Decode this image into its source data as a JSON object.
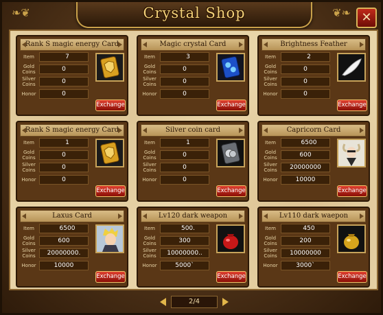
{
  "window": {
    "title": "Crystal Shop",
    "close_label": "✕"
  },
  "labels": {
    "item": "Item",
    "gold": "Gold Coins",
    "silver": "Silver Coins",
    "honor": "Honor"
  },
  "exchange_label": "Exchange",
  "pager": {
    "text": "2/4"
  },
  "cards": [
    {
      "title": "Rank S magic energy Card",
      "item_icon": "green-egg",
      "item": "7",
      "gold": "0",
      "silver": "0",
      "honor": "0",
      "image": "gold-shield-card"
    },
    {
      "title": "Magic crystal Card",
      "item_icon": "green-egg",
      "item": "3",
      "gold": "0",
      "silver": "0",
      "honor": "0",
      "image": "blue-crystal-card"
    },
    {
      "title": "Brightness Feather",
      "item_icon": "green-egg",
      "item": "2",
      "gold": "0",
      "silver": "0",
      "honor": "0",
      "image": "white-feather"
    },
    {
      "title": "Rank S magic energy Card",
      "item_icon": "green-egg",
      "item": "1",
      "gold": "0",
      "silver": "0",
      "honor": "0",
      "image": "gold-shield-card"
    },
    {
      "title": "Silver coin card",
      "item_icon": "green-egg",
      "item": "1",
      "gold": "0",
      "silver": "0",
      "honor": "0",
      "image": "silver-coin-card"
    },
    {
      "title": "Capricorn Card",
      "item_icon": "dark-gem",
      "item": "6500",
      "gold": "600",
      "silver": "20000000",
      "honor": "10000",
      "image": "capricorn-portrait"
    },
    {
      "title": "Laxus Card",
      "item_icon": "dark-gem",
      "item": "6500",
      "gold": "600",
      "silver": "20000000.",
      "honor": "10000",
      "image": "laxus-portrait"
    },
    {
      "title": "Lv120 dark weapon",
      "item_icon": "dark-gem",
      "item": "500.",
      "gold": "300",
      "silver": "10000000..",
      "honor": "5000`",
      "image": "red-bag"
    },
    {
      "title": "Lv110 dark waepon",
      "item_icon": "dark-gem",
      "item": "450",
      "gold": "200",
      "silver": "10000000",
      "honor": "3000`",
      "image": "gold-bag"
    }
  ]
}
